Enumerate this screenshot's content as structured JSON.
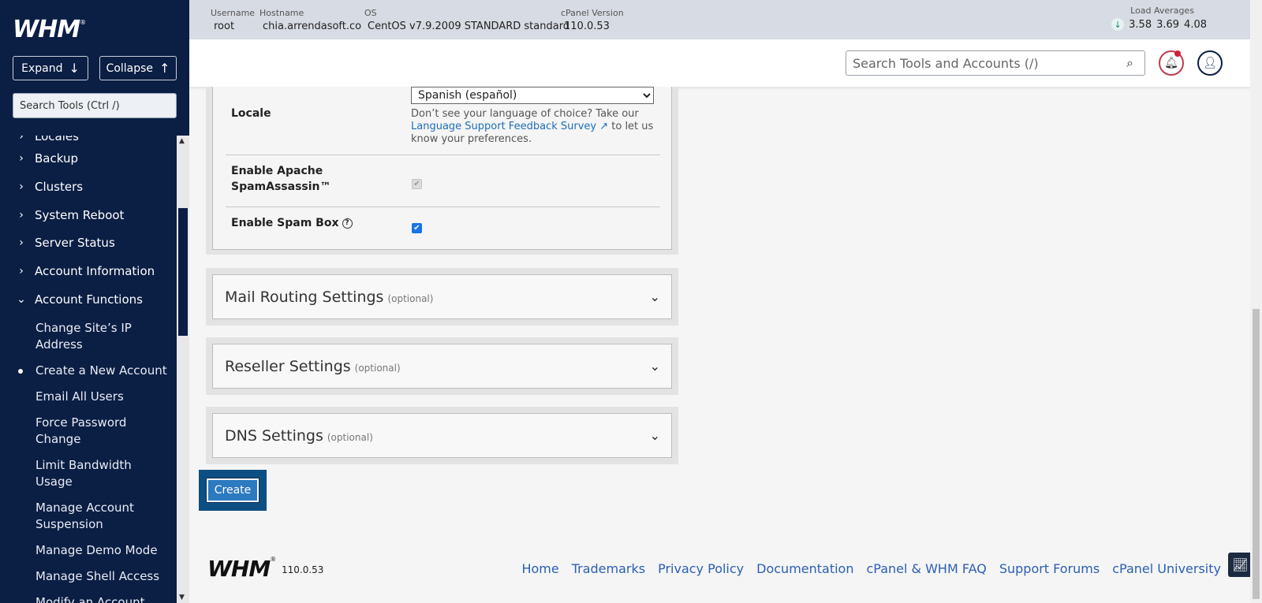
{
  "sidebar": {
    "logo_text": "WHM",
    "expand_label": "Expand",
    "collapse_label": "Collapse",
    "search_placeholder": "Search Tools (Ctrl /)",
    "partial_top_label": "Locales",
    "categories": [
      {
        "label": "Backup"
      },
      {
        "label": "Clusters"
      },
      {
        "label": "System Reboot"
      },
      {
        "label": "Server Status"
      },
      {
        "label": "Account Information"
      },
      {
        "label": "Account Functions"
      }
    ],
    "sub_items": [
      {
        "label": "Change Site’s IP Address"
      },
      {
        "label": "Create a New Account"
      },
      {
        "label": "Email All Users"
      },
      {
        "label": "Force Password Change"
      },
      {
        "label": "Limit Bandwidth Usage"
      },
      {
        "label": "Manage Account Suspension"
      },
      {
        "label": "Manage Demo Mode"
      },
      {
        "label": "Manage Shell Access"
      },
      {
        "label": "Modify an Account"
      }
    ]
  },
  "infobar": {
    "username_label": "Username",
    "username": "root",
    "hostname_label": "Hostname",
    "hostname": "chia.arrendasoft.co",
    "os_label": "OS",
    "os": "CentOS v7.9.2009 STANDARD standard",
    "cpanel_label": "cPanel Version",
    "cpanel_version": "110.0.53",
    "load_label": "Load Averages",
    "load": [
      "3.58",
      "3.69",
      "4.08"
    ]
  },
  "toolbar": {
    "search_placeholder": "Search Tools and Accounts (/)"
  },
  "form": {
    "locale_label": "Locale",
    "locale_value": "Spanish (español)",
    "locale_help_1": "Don’t see your language of choice? Take our ",
    "locale_help_link": "Language Support Feedback Survey",
    "locale_help_2": " to let us know your preferences.",
    "apache_label": "Enable Apache SpamAssassin™",
    "spambox_label": "Enable Spam Box",
    "sections": [
      {
        "title": "Mail Routing Settings",
        "optional": "(optional)"
      },
      {
        "title": "Reseller Settings",
        "optional": "(optional)"
      },
      {
        "title": "DNS Settings",
        "optional": "(optional)"
      }
    ],
    "create_label": "Create"
  },
  "footer": {
    "logo_text": "WHM",
    "version": "110.0.53",
    "links": [
      "Home",
      "Trademarks",
      "Privacy Policy",
      "Documentation",
      "cPanel & WHM FAQ",
      "Support Forums",
      "cPanel University"
    ]
  }
}
